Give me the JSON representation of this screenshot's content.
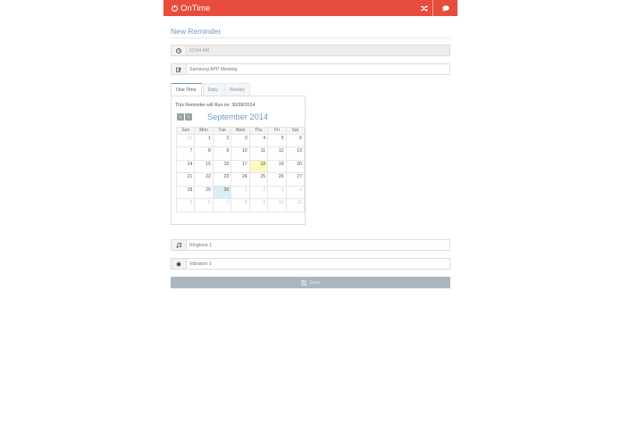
{
  "app": {
    "title": "OnTime"
  },
  "page": {
    "title": "New Reminder"
  },
  "time_field": {
    "value": "12:54 AM"
  },
  "title_field": {
    "value": "Samsung APP Meeting"
  },
  "tabs": [
    {
      "label": "One Time",
      "active": true
    },
    {
      "label": "Daily",
      "active": false
    },
    {
      "label": "Weekly",
      "active": false
    }
  ],
  "schedule": {
    "run_text": "This Reminder will Run on: 30/09/2014"
  },
  "calendar": {
    "month_label": "September 2014",
    "weekdays": [
      "Sun",
      "Mon",
      "Tue",
      "Wed",
      "Thu",
      "Fri",
      "Sat"
    ],
    "weeks": [
      [
        {
          "d": "31",
          "other": true
        },
        {
          "d": "1"
        },
        {
          "d": "2"
        },
        {
          "d": "3"
        },
        {
          "d": "4"
        },
        {
          "d": "5"
        },
        {
          "d": "6"
        }
      ],
      [
        {
          "d": "7"
        },
        {
          "d": "8"
        },
        {
          "d": "9"
        },
        {
          "d": "10"
        },
        {
          "d": "11"
        },
        {
          "d": "12"
        },
        {
          "d": "13"
        }
      ],
      [
        {
          "d": "14"
        },
        {
          "d": "15"
        },
        {
          "d": "16"
        },
        {
          "d": "17"
        },
        {
          "d": "18",
          "today": true
        },
        {
          "d": "19"
        },
        {
          "d": "20"
        }
      ],
      [
        {
          "d": "21"
        },
        {
          "d": "22"
        },
        {
          "d": "23"
        },
        {
          "d": "24"
        },
        {
          "d": "25"
        },
        {
          "d": "26"
        },
        {
          "d": "27"
        }
      ],
      [
        {
          "d": "28"
        },
        {
          "d": "29"
        },
        {
          "d": "30",
          "selected": true
        },
        {
          "d": "1",
          "other": true
        },
        {
          "d": "2",
          "other": true
        },
        {
          "d": "3",
          "other": true
        },
        {
          "d": "4",
          "other": true
        }
      ],
      [
        {
          "d": "5",
          "other": true
        },
        {
          "d": "6",
          "other": true
        },
        {
          "d": "7",
          "other": true
        },
        {
          "d": "8",
          "other": true
        },
        {
          "d": "9",
          "other": true
        },
        {
          "d": "10",
          "other": true
        },
        {
          "d": "11",
          "other": true
        }
      ]
    ],
    "prev_glyph": "‹",
    "next_glyph": "›"
  },
  "ringtone_field": {
    "value": "Ringtone 1"
  },
  "vibration_field": {
    "value": "Vibration 1"
  },
  "save_button": {
    "label": "Save"
  },
  "icons": {
    "time": "clock-icon",
    "title": "edit-icon",
    "ringtone": "music-note-icon",
    "vibration": "vibration-icon",
    "shuffle": "shuffle-icon",
    "chat": "chat-icon",
    "save": "floppy-disk-icon"
  },
  "colors": {
    "navbar": "#e74c3c",
    "accent": "#6b9bc6",
    "save_button": "#a9b7bf",
    "today": "#fcf8c3"
  }
}
